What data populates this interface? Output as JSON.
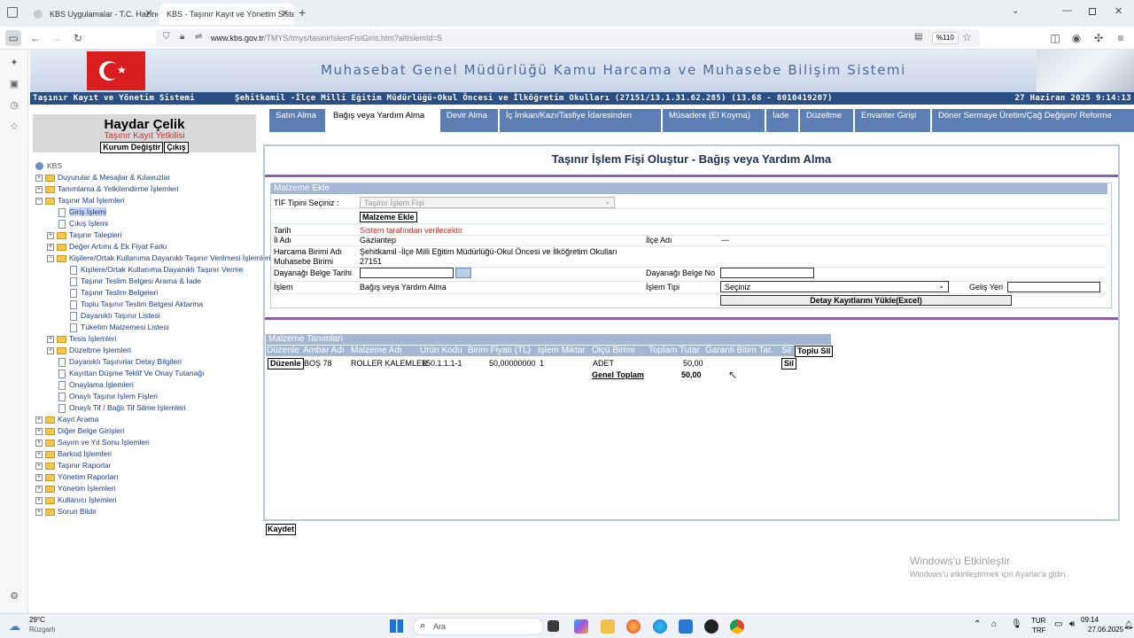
{
  "browser": {
    "tabs": [
      {
        "title": "KBS Uygulamalar - T.C. Hazine ve"
      },
      {
        "title": "KBS - Taşınır Kayıt ve Yönetim Sistem"
      }
    ],
    "url_host": "www.kbs.gov.tr",
    "url_path": "/TMYS/tmys/tasinirIslemFisiGiris.htm?altIslemId=5",
    "zoom": "%110"
  },
  "banner": {
    "title": "Muhasebat Genel Müdürlüğü Kamu Harcama ve Muhasebe Bilişim Sistemi"
  },
  "status": {
    "system": "Taşınır Kayıt ve Yönetim Sistemi",
    "unit": "Şehitkamil -İlçe Milli Eğitim Müdürlüğü-Okul Öncesi ve İlköğretim Okulları (27151/13.1.31.62.285) (13.68 - 8010419207)",
    "datetime": "27 Haziran 2025 9:14:13"
  },
  "user": {
    "name": "Haydar Çelik",
    "role": "Taşınır Kayıt Yetkilisi",
    "change_label": "Kurum Değiştir",
    "logout_label": "Çıkış"
  },
  "tree": {
    "root": "KBS",
    "items": [
      "Duyurular & Mesajlar & Kılavuzlar",
      "Tanımlama & Yetkilendirme İşlemleri",
      "Taşınır Mal İşlemleri",
      "Giriş İşlemi",
      "Çıkış İşlemi",
      "Taşınır Talepleri",
      "Değer Artımı & Ek Fiyat Farkı",
      "Kişilere/Ortak Kullanıma Dayanıklı Taşınır Verilmesi İşlemleri",
      "Kişilere/Ortak Kullanıma Dayanıklı Taşınır Verme",
      "Taşınır Teslim Belgesi Arama & İade",
      "Taşınır Teslim Belgeleri",
      "Toplu Taşınır Teslim Belgesi Aktarma",
      "Dayanıklı Taşınır Listesi",
      "Tüketim Malzemesi Listesi",
      "Tesis İşlemleri",
      "Düzeltme İşlemleri",
      "Dayanıklı Taşınırlar Detay Bilgileri",
      "Kayıttan Düşme Teklif Ve Onay Tutanağı",
      "Onaylama İşlemleri",
      "Onaylı Taşınır İşlem Fişleri",
      "Onaylı Tif / Bağlı Tif Silme İşlemleri",
      "Kayıt Arama",
      "Diğer Belge Girişleri",
      "Sayım ve Yıl Sonu İşlemleri",
      "Barkod İşlemleri",
      "Taşınır Raporlar",
      "Yönetim Raporları",
      "Yönetim İşlemleri",
      "Kullanıcı İşlemleri",
      "Sorun Bildir"
    ]
  },
  "menu": {
    "tabs": [
      "Satın Alma",
      "Bağış veya Yardım Alma",
      "Devir Alma",
      "İç İmkan/Kazı/Tasfiye İdaresinden",
      "Müsadere (El Koyma)",
      "İade",
      "Düzeltme",
      "Envanter Girişi",
      "Döner Sermaye Üretim/Çağ Değişim/ Reforme"
    ]
  },
  "form": {
    "title": "Taşınır İşlem Fişi Oluştur - Bağış veya Yardım Alma",
    "section": "Malzeme Ekle",
    "tif_label": "TİF Tipini Seçiniz :",
    "tif_value": "Taşınır İşlem Fişi",
    "add_button": "Malzeme Ekle",
    "tarih_label": "Tarih",
    "tarih_value": "Sistem tarafından verilecektir",
    "il_label": "İl Adı",
    "il_value": "Gaziantep",
    "ilce_label": "İlçe Adı",
    "ilce_value": "---",
    "harcama_label": "Harcama Birimi Adı",
    "harcama_value": "Şehitkamil -İlçe Milli Eğitim Müdürlüğü-Okul Öncesi ve İlköğretim Okulları",
    "muhasebe_label": "Muhasebe Birimi",
    "muhasebe_value": "27151",
    "dayanak_tarih_label": "Dayanağı Belge Tarihi",
    "dayanak_no_label": "Dayanağı Belge No",
    "islem_label": "İşlem",
    "islem_value": "Bağış veya Yardım Alma",
    "islem_tipi_label": "İşlem Tipi",
    "islem_tipi_value": "Seçiniz",
    "gelis_label": "Geliş Yeri",
    "excel_button": "Detay Kayıtlarını Yükle(Excel)"
  },
  "materials": {
    "section": "Malzeme Tanımları",
    "headers": [
      "Düzenle",
      "Ambar Adı",
      "Malzeme Adı",
      "Ürün Kodu",
      "Birim Fiyatı (TL)",
      "İşlem Miktar",
      "Ölçü Birimi",
      "Toplam Tutar",
      "Garanti Bitim Tar.",
      "Sil"
    ],
    "toplu_sil": "Toplu Sil",
    "row": {
      "edit": "Düzenle",
      "ambar": "BOŞ 78",
      "malzeme": "ROLLER KALEMLER",
      "kod": "150.1.1.1-1",
      "fiyat": "50,00000000",
      "miktar": "1",
      "birim": "ADET",
      "tutar": "50,00",
      "sil": "Sil"
    },
    "total_label": "Genel Toplam",
    "total_value": "50,00"
  },
  "save_label": "Kaydet",
  "watermark": {
    "line1": "Windows'u Etkinleştir",
    "line2": "Windows'u etkinleştirmek için Ayarlar'a gidin."
  },
  "taskbar": {
    "temp": "29°C",
    "weather": "Rüzgarlı",
    "search": "Ara",
    "lang1": "TUR",
    "lang2": "TRF",
    "time": "09:14",
    "date": "27.06.2025"
  }
}
